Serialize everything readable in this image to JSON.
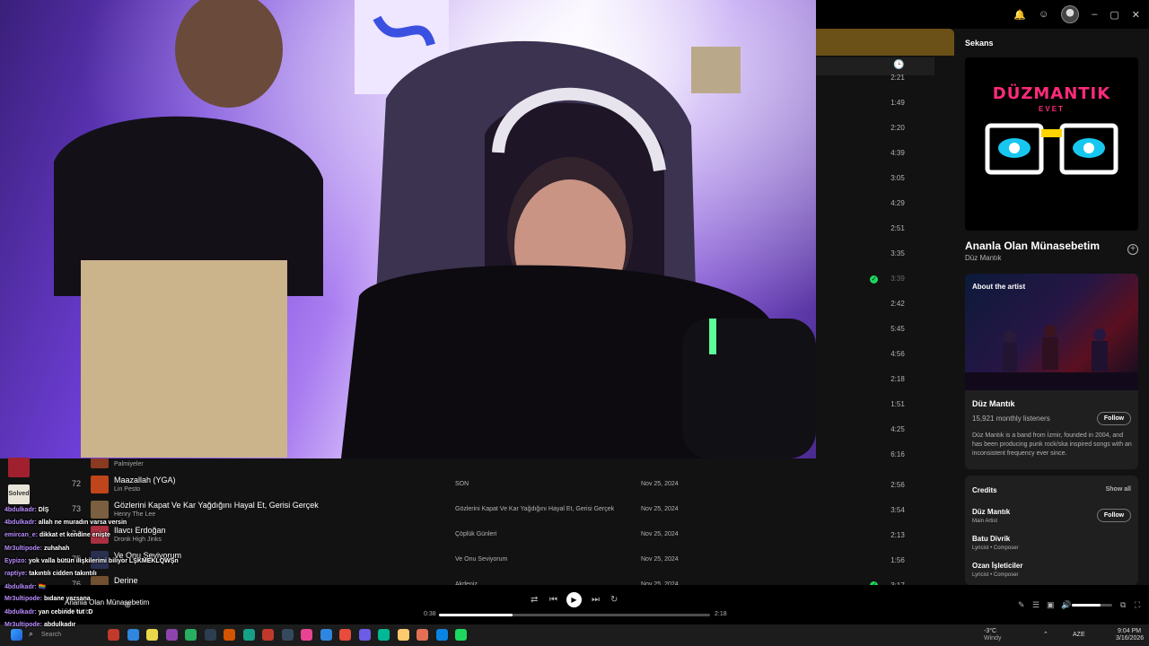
{
  "window": {
    "top_icons": [
      "bell-icon",
      "friends-icon",
      "avatar",
      "minimize",
      "maximize",
      "close"
    ]
  },
  "tracklist": {
    "durations": [
      "2:21",
      "1:49",
      "2:20",
      "4:39",
      "3:05",
      "4:29",
      "2:51",
      "3:35",
      "3:39",
      "2:42",
      "5:45",
      "4:56",
      "2:18",
      "1:51",
      "4:25",
      "6:16"
    ],
    "saved_duration": "3:39",
    "rows": [
      {
        "num": "",
        "title": "",
        "artist": "Palmiyeler",
        "album": "",
        "date": "",
        "duration": ""
      },
      {
        "num": "72",
        "title": "Maazallah (YGA)",
        "artist": "Lin Pesto",
        "album": "SON",
        "date": "Nov 25, 2024",
        "duration": "2:56"
      },
      {
        "num": "73",
        "title": "Gözlerini Kapat Ve Kar Yağdığını Hayal Et, Gerisi Gerçek",
        "artist": "Henry The Lee",
        "album": "Gözlerini Kapat Ve Kar Yağdığını Hayal Et, Gerisi Gerçek",
        "date": "Nov 25, 2024",
        "duration": "3:54"
      },
      {
        "num": "74",
        "title": "Ilavcı Erdoğan",
        "artist": "Dronk High Jinks",
        "album": "Çöplük Günleri",
        "date": "Nov 25, 2024",
        "duration": "2:13"
      },
      {
        "num": "75",
        "title": "Ve Onu Seviyorum",
        "artist": "",
        "album": "Ve Onu Seviyorum",
        "date": "Nov 25, 2024",
        "duration": "1:56"
      },
      {
        "num": "76",
        "title": "Derine",
        "artist": "Palmiyeler",
        "album": "Akdeniz",
        "date": "Nov 25, 2024",
        "duration": "3:17",
        "saved": true
      }
    ]
  },
  "right_panel": {
    "title": "Sekans",
    "logo_text": "DÜZMANTIK",
    "logo_sub": "EVET",
    "song_title": "Ananla Olan Münasebetim",
    "song_artist": "Düz Mantık",
    "about": {
      "label": "About the artist",
      "artist": "Düz Mantık",
      "listeners": "15,921 monthly listeners",
      "follow": "Follow",
      "bio": "Düz Mantık is a band from İzmir, founded in 2004, and has been producing punk rock/ska inspired songs with an inconsistent frequency ever since."
    },
    "credits": {
      "label": "Credits",
      "show_all": "Show all",
      "items": [
        {
          "name": "Düz Mantık",
          "role": "Main Artist",
          "follow": "Follow"
        },
        {
          "name": "Batu Divrik",
          "role": "Lyricist • Composer"
        },
        {
          "name": "Ozan İşleticiler",
          "role": "Lyricist • Composer"
        }
      ]
    }
  },
  "now_playing": {
    "title": "Ananla Olan Münasebetim",
    "artist": "Düz Mantık",
    "elapsed": "0:38",
    "total": "2:18",
    "progress": 0.27,
    "volume": 0.7
  },
  "chat": {
    "messages": [
      {
        "user": "4bdulkadr:",
        "msg": "DİŞ"
      },
      {
        "user": "4bdulkadr:",
        "msg": "allah ne muradın varsa versin"
      },
      {
        "user": "emircan_e:",
        "msg": "dikkat et kendine enişte"
      },
      {
        "user": "Mr3ultipode:",
        "msg": "zuhahah"
      },
      {
        "user": "Eypizo:",
        "msg": "yok valla bütün ilişkilerimi biliyor LŞKMEKLQWŞn"
      },
      {
        "user": "raptiye:",
        "msg": "takıntılı cidden takıntılı"
      },
      {
        "user": "4bdulkadr:",
        "msg": "🏳‍🌈"
      },
      {
        "user": "Mr3ultipode:",
        "msg": "bıdane yazsana"
      },
      {
        "user": "4bdulkadr:",
        "msg": "yan cebinde tut :D"
      },
      {
        "user": "Mr3ultipode:",
        "msg": "abdulkadır"
      }
    ],
    "badge_text": "Solved"
  },
  "taskbar": {
    "weather_temp": "-3°C",
    "weather_desc": "Windy",
    "lang": "AZE",
    "time": "9:04 PM",
    "date": "3/16/2026",
    "search_placeholder": "Search"
  },
  "colors": {
    "spotify_green": "#1ed760",
    "banner": "#6b5018",
    "logo_pink": "#ff2a7a",
    "logo_cyan": "#17c7f0",
    "logo_yellow": "#ffd400",
    "chat_user": "#b88cff"
  }
}
